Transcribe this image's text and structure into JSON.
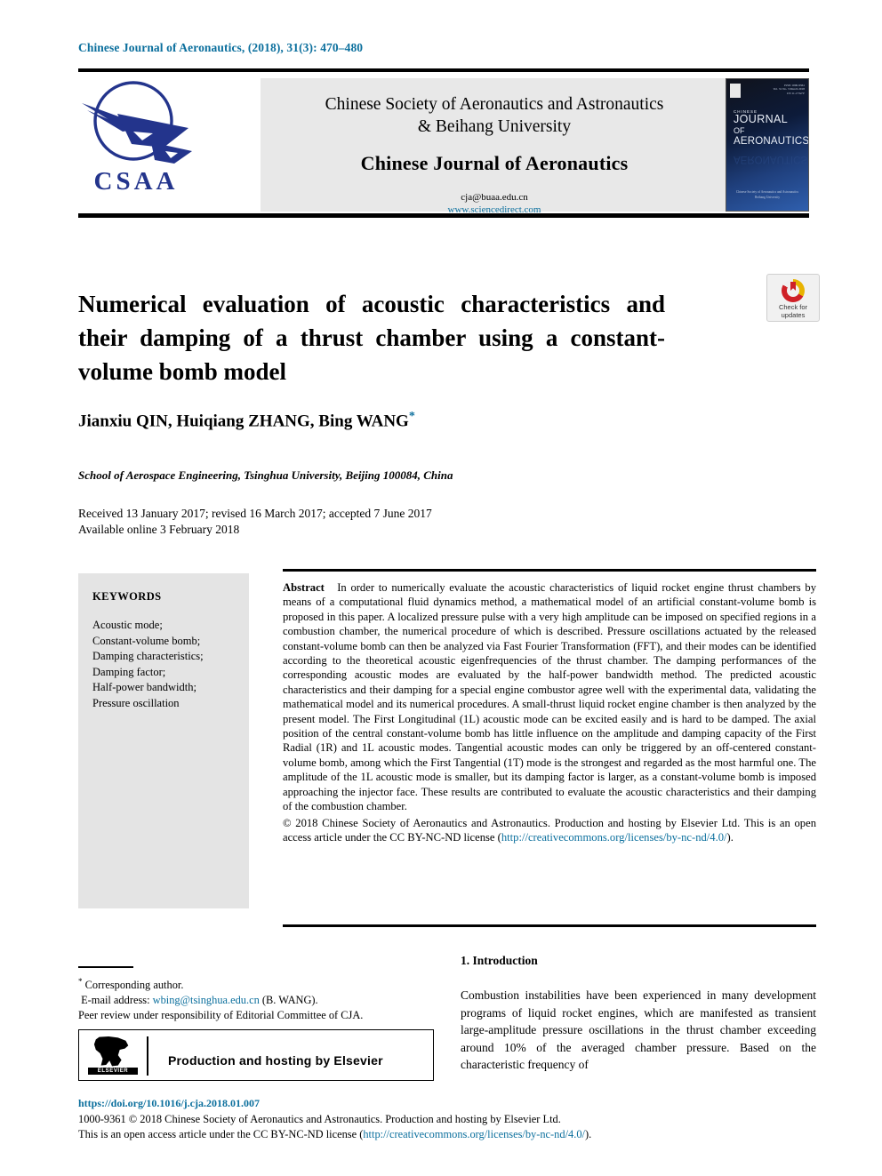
{
  "running_head": "Chinese Journal of Aeronautics, (2018), 31(3): 470–480",
  "masthead": {
    "logo_text": "CSAA",
    "society_line1": "Chinese Society of Aeronautics and Astronautics",
    "society_line2": "& Beihang University",
    "journal_name": "Chinese Journal of Aeronautics",
    "email": "cja@buaa.edu.cn",
    "url": "www.sciencedirect.com",
    "cover": {
      "issn_block": "ISSN 1000-9361\nVol. 31 No. 3 March 2018\nCN 11-1732/V",
      "chinese_label": "CHINESE",
      "line_journal": "JOURNAL",
      "line_of": "OF",
      "line_aeronautics": "AERONAUTICS",
      "footer_line1": "Chinese Society of Aeronautics and Astronautics",
      "footer_line2": "Beihang University"
    }
  },
  "article": {
    "title": "Numerical evaluation of acoustic characteristics and their damping of a thrust chamber using a constant-volume bomb model",
    "authors": "Jianxiu QIN, Huiqiang ZHANG, Bing WANG",
    "corresponding_marker": "*",
    "affiliation": "School of Aerospace Engineering, Tsinghua University, Beijing 100084, China",
    "history_line1": "Received 13 January 2017; revised 16 March 2017; accepted 7 June 2017",
    "history_line2": "Available online 3 February 2018"
  },
  "crossmark": {
    "line1": "Check for",
    "line2": "updates"
  },
  "keywords": {
    "heading": "KEYWORDS",
    "items": [
      "Acoustic mode;",
      "Constant-volume bomb;",
      "Damping characteristics;",
      "Damping factor;",
      "Half-power bandwidth;",
      "Pressure oscillation"
    ]
  },
  "abstract": {
    "label": "Abstract",
    "text": "In order to numerically evaluate the acoustic characteristics of liquid rocket engine thrust chambers by means of a computational fluid dynamics method, a mathematical model of an artificial constant-volume bomb is proposed in this paper. A localized pressure pulse with a very high amplitude can be imposed on specified regions in a combustion chamber, the numerical procedure of which is described. Pressure oscillations actuated by the released constant-volume bomb can then be analyzed via Fast Fourier Transformation (FFT), and their modes can be identified according to the theoretical acoustic eigenfrequencies of the thrust chamber. The damping performances of the corresponding acoustic modes are evaluated by the half-power bandwidth method. The predicted acoustic characteristics and their damping for a special engine combustor agree well with the experimental data, validating the mathematical model and its numerical procedures. A small-thrust liquid rocket engine chamber is then analyzed by the present model. The First Longitudinal (1L) acoustic mode can be excited easily and is hard to be damped. The axial position of the central constant-volume bomb has little influence on the amplitude and damping capacity of the First Radial (1R) and 1L acoustic modes. Tangential acoustic modes can only be triggered by an off-centered constant-volume bomb, among which the First Tangential (1T) mode is the strongest and regarded as the most harmful one. The amplitude of the 1L acoustic mode is smaller, but its damping factor is larger, as a constant-volume bomb is imposed approaching the injector face. These results are contributed to evaluate the acoustic characteristics and their damping of the combustion chamber.",
    "copyright_pre": "© 2018 Chinese Society of Aeronautics and Astronautics. Production and hosting by Elsevier Ltd. This is an open access article under the CC BY-NC-ND license (",
    "copyright_link": "http://creativecommons.org/licenses/by-nc-nd/4.0/",
    "copyright_post": ")."
  },
  "footnote": {
    "star": "*",
    "corresponding": "Corresponding author.",
    "email_label": "E-mail address:",
    "email": "wbing@tsinghua.edu.cn",
    "email_suffix": "(B. WANG).",
    "peer_review": "Peer review under responsibility of Editorial Committee of CJA.",
    "elsevier_banner": "Production and hosting by Elsevier",
    "elsevier_wordmark": "ELSEVIER"
  },
  "introduction": {
    "heading": "1. Introduction",
    "paragraph": "Combustion instabilities have been experienced in many development programs of liquid rocket engines, which are manifested as transient large-amplitude pressure oscillations in the thrust chamber exceeding around 10% of the averaged chamber pressure. Based on the characteristic frequency of"
  },
  "bottom": {
    "doi": "https://doi.org/10.1016/j.cja.2018.01.007",
    "issn_copyright": "1000-9361 © 2018 Chinese Society of Aeronautics and Astronautics. Production and hosting by Elsevier Ltd.",
    "license_pre": "This is an open access article under the CC BY-NC-ND license (",
    "license_link": "http://creativecommons.org/licenses/by-nc-nd/4.0/",
    "license_post": ")."
  },
  "colors": {
    "link": "#0b6f9d",
    "logo_blue": "#23348c",
    "keywords_bg": "#e4e4e4",
    "masthead_bg": "#e8e8e8"
  }
}
